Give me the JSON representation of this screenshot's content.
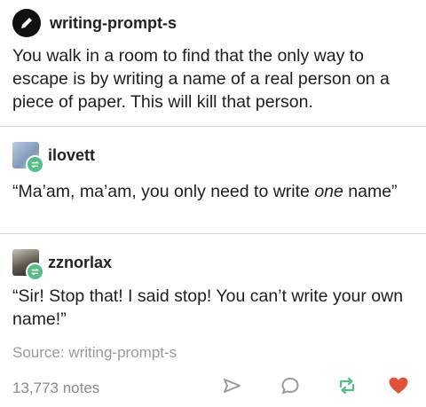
{
  "original_post": {
    "username": "writing-prompt-s",
    "text": "You walk in a room to find that the only way to escape is by writing a name of a real person on a piece of paper. This will kill that person."
  },
  "reblog_1": {
    "username": "ilovett",
    "text_before": "“Ma’am, ma’am, you only need to write ",
    "text_emphasis": "one",
    "text_after": " name”"
  },
  "reblog_2": {
    "username": "zznorlax",
    "text": "“Sir! Stop that! I said stop! You can’t write your own name!”"
  },
  "source": "Source: writing-prompt-s",
  "notes": "13,773 notes",
  "colors": {
    "reblog_green": "#56bc8a",
    "like_red": "#e0533a",
    "icon_gray": "#9a9a9a"
  },
  "icons": [
    "pencil-icon",
    "share-icon",
    "reply-icon",
    "reblog-icon",
    "heart-icon"
  ]
}
